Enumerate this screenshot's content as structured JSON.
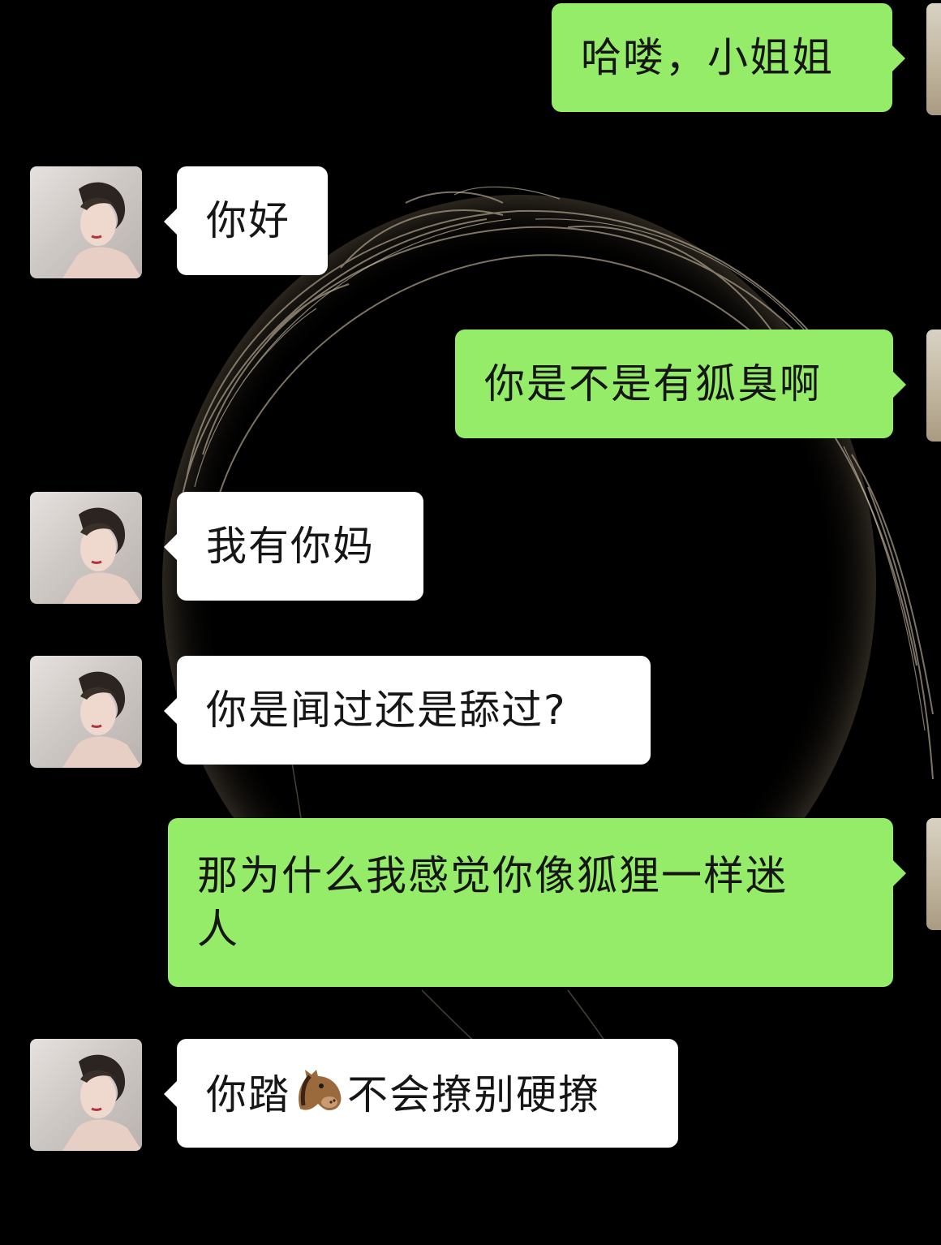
{
  "messages": [
    {
      "side": "out",
      "text": "哈喽，小姐姐"
    },
    {
      "side": "in",
      "text": "你好"
    },
    {
      "side": "out",
      "text": "你是不是有狐臭啊"
    },
    {
      "side": "in",
      "text": "我有你妈"
    },
    {
      "side": "in",
      "text": "你是闻过还是舔过?"
    },
    {
      "side": "out",
      "line1": "那为什么我感觉你像狐狸一样迷",
      "line2": "人"
    },
    {
      "side": "in",
      "before_emoji": "你踏",
      "emoji": "horse-face-icon",
      "after_emoji": "不会撩别硬撩"
    }
  ],
  "colors": {
    "background": "#000000",
    "outgoing_bubble": "#95ec69",
    "incoming_bubble": "#ffffff",
    "text": "#161616"
  }
}
